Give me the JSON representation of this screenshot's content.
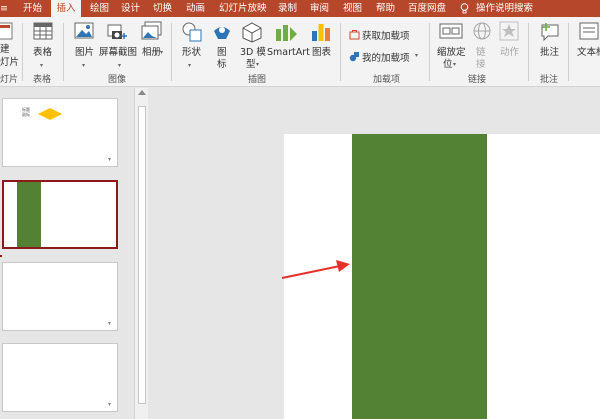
{
  "tabs": [
    {
      "label": "开始"
    },
    {
      "label": "插入",
      "active": true
    },
    {
      "label": "绘图"
    },
    {
      "label": "设计"
    },
    {
      "label": "切换"
    },
    {
      "label": "动画"
    },
    {
      "label": "幻灯片放映"
    },
    {
      "label": "录制"
    },
    {
      "label": "审阅"
    },
    {
      "label": "视图"
    },
    {
      "label": "帮助"
    },
    {
      "label": "百度网盘"
    },
    {
      "label": "操作说明搜索",
      "icon": "lightbulb-icon"
    }
  ],
  "ribbon": {
    "slides_group": {
      "new_slide_line1": "建",
      "new_slide_line2": "灯片",
      "group_label": "灯片"
    },
    "table_group": {
      "table_label": "表格",
      "group_label": "表格"
    },
    "images_group": {
      "picture": "图片",
      "screenshot": "屏幕截图",
      "album": "相册",
      "group_label": "图像"
    },
    "illustrations_group": {
      "shapes": "形状",
      "icons_line1": "图",
      "icons_line2": "标",
      "model3d_line1": "3D 模",
      "model3d_line2": "型",
      "smartart": "SmartArt",
      "chart": "图表",
      "group_label": "插图"
    },
    "addins_group": {
      "get_addins": "获取加载项",
      "my_addins": "我的加载项",
      "group_label": "加载项"
    },
    "links_group": {
      "zoom_line1": "缩放定",
      "zoom_line2": "位",
      "link_line1": "链",
      "link_line2": "接",
      "action": "动作",
      "group_label": "链接"
    },
    "comments_group": {
      "comment": "批注",
      "group_label": "批注"
    },
    "text_group": {
      "textbox": "文本框"
    }
  },
  "slides_panel": {
    "thumb1_caption": "标题\n副标"
  },
  "colors": {
    "tab_bar": "#b7472a",
    "shape_fill": "#548235",
    "selected_thumb_border": "#8b1a1a",
    "arrow": "#e8302a",
    "diamond": "#ffc000"
  }
}
